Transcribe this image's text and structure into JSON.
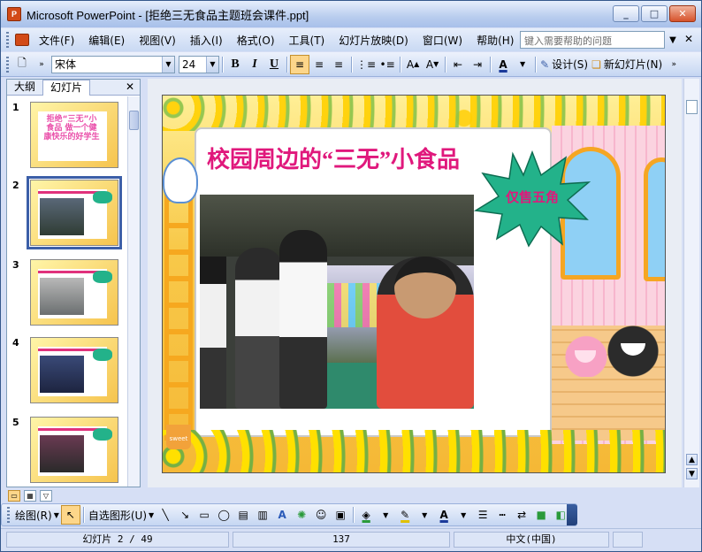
{
  "window": {
    "title": "Microsoft PowerPoint - [拒绝三无食品主题班会课件.ppt]",
    "app_icon_label": "P",
    "minimize": "_",
    "maximize": "□",
    "close": "✕"
  },
  "menu": {
    "items": [
      "文件(F)",
      "编辑(E)",
      "视图(V)",
      "插入(I)",
      "格式(O)",
      "工具(T)",
      "幻灯片放映(D)",
      "窗口(W)",
      "帮助(H)"
    ],
    "help_placeholder": "键入需要帮助的问题",
    "close_doc": "✕"
  },
  "toolbar": {
    "font_name": "宋体",
    "font_size": "24",
    "bold": "B",
    "italic": "I",
    "underline": "U",
    "design_label": "设计(S)",
    "new_slide_label": "新幻灯片(N)"
  },
  "pane": {
    "tab_outline": "大纲",
    "tab_slides": "幻灯片",
    "close": "✕",
    "slides": [
      {
        "num": "1",
        "title_preview": "拒绝“三无”小食品 做一个健康快乐的好学生"
      },
      {
        "num": "2",
        "title_preview": ""
      },
      {
        "num": "3",
        "title_preview": ""
      },
      {
        "num": "4",
        "title_preview": ""
      },
      {
        "num": "5",
        "title_preview": ""
      }
    ],
    "selected_index": 1
  },
  "slide": {
    "title": "校园周边的“三无”小食品",
    "burst_text": "仅售五角",
    "basket_label": "sweet"
  },
  "drawbar": {
    "draw_label": "绘图(R)",
    "autoshape_label": "自选图形(U)"
  },
  "status": {
    "slide_info": "幻灯片 2 / 49",
    "design": "137",
    "language": "中文(中国)"
  },
  "colors": {
    "title_color": "#e0187c",
    "burst_fill": "#23b28a",
    "selection_outline": "#3c5fa8"
  }
}
